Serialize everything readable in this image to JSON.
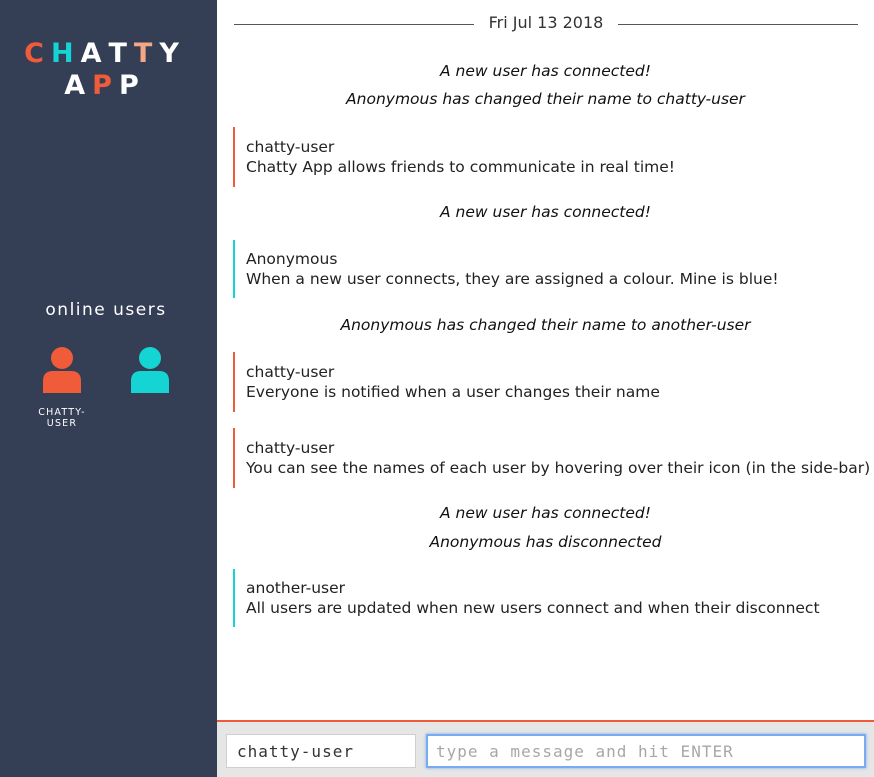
{
  "colors": {
    "sidebar_bg": "#343e55",
    "orange": "#f05b3a",
    "cyan": "#15d4d4",
    "peach": "#f5a685",
    "input_focus": "#7aaaf0"
  },
  "logo": {
    "line1": [
      {
        "ch": "C",
        "color": "#f05b3a"
      },
      {
        "ch": "H",
        "color": "#15d4d4"
      },
      {
        "ch": "A",
        "color": "#ffffff"
      },
      {
        "ch": "T",
        "color": "#ffffff"
      },
      {
        "ch": "T",
        "color": "#f5a685"
      },
      {
        "ch": "Y",
        "color": "#ffffff"
      }
    ],
    "line2": [
      {
        "ch": "A",
        "color": "#ffffff"
      },
      {
        "ch": "P",
        "color": "#f05b3a"
      },
      {
        "ch": "P",
        "color": "#ffffff"
      }
    ]
  },
  "sidebar": {
    "online_title": "online users",
    "users": [
      {
        "icon": "user-icon",
        "color": "#f05b3a",
        "label": "CHATTY-USER"
      },
      {
        "icon": "user-icon",
        "color": "#15d4d4",
        "label": ""
      }
    ]
  },
  "chat": {
    "date": "Fri Jul 13 2018",
    "items": [
      {
        "type": "notification",
        "text": "A new user has connected!"
      },
      {
        "type": "notification",
        "text": "Anonymous has changed their name to chatty-user"
      },
      {
        "type": "message",
        "user": "chatty-user",
        "content": "Chatty App allows friends to communicate in real time!",
        "color": "#f05b3a"
      },
      {
        "type": "notification",
        "text": "A new user has connected!"
      },
      {
        "type": "message",
        "user": "Anonymous",
        "content": "When a new user connects, they are assigned a colour. Mine is blue!",
        "color": "#15d4d4"
      },
      {
        "type": "notification",
        "text": "Anonymous has changed their name to another-user"
      },
      {
        "type": "message",
        "user": "chatty-user",
        "content": "Everyone is notified when a user changes their name",
        "color": "#f05b3a"
      },
      {
        "type": "message",
        "user": "chatty-user",
        "content": "You can see the names of each user by hovering over their icon (in the side-bar)",
        "color": "#f05b3a"
      },
      {
        "type": "notification",
        "text": "A new user has connected!"
      },
      {
        "type": "notification",
        "text": "Anonymous has disconnected"
      },
      {
        "type": "message",
        "user": "another-user",
        "content": "All users are updated when new users connect and when their disconnect",
        "color": "#15d4d4"
      }
    ]
  },
  "composer": {
    "username_value": "chatty-user",
    "message_placeholder": "type a message and hit ENTER"
  }
}
